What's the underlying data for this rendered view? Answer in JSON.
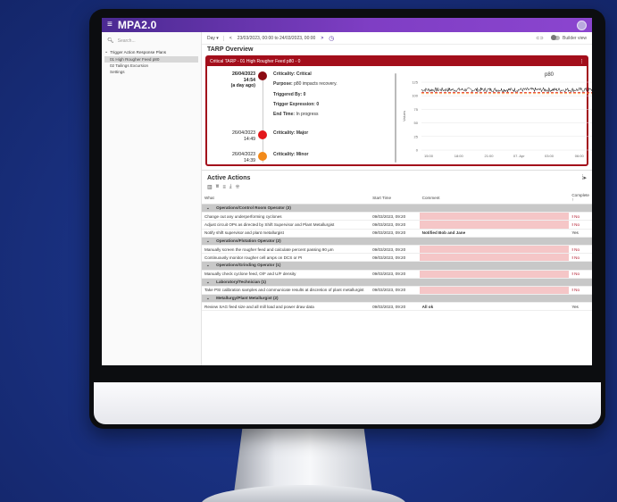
{
  "app": {
    "title": "MPA2.0",
    "menu_icon": "hamburger-icon",
    "avatar_icon": "user-avatar-icon"
  },
  "sidebar": {
    "search_placeholder": "Search...",
    "tree_root": "Trigger Action Response Plans",
    "items": [
      {
        "label": "01 High Rougher Feed p80",
        "active": true
      },
      {
        "label": "02 Tailings Excursion",
        "active": false
      },
      {
        "label": "Settings",
        "active": false
      }
    ]
  },
  "toolbar": {
    "period": "Day",
    "range": "23/03/2023, 00:00 to 24/03/2023, 00:00",
    "prev_glyph": "<",
    "next_glyph": ">",
    "link_icon": "link-icon",
    "builder_label": "Builder view"
  },
  "tarp": {
    "section_title": "TARP Overview",
    "card_title": "Critical TARP - 01 High Rougher Feed p80 - 0",
    "events": [
      {
        "date": "26/04/2023",
        "time": "14:54",
        "ago": "(a day ago)",
        "color": "#8b0a12",
        "criticality": "Criticality: Critical",
        "purpose_label": "Purpose:",
        "purpose": "p80 impacts recovery.",
        "triggered": "Triggered By: 0",
        "expression": "Trigger Expression: 0",
        "end_time_label": "End Time:",
        "end_time": "In progress"
      },
      {
        "date": "26/04/2023",
        "time": "14:49",
        "color": "#e3171b",
        "criticality": "Criticality: Major"
      },
      {
        "date": "26/04/2023",
        "time": "14:39",
        "color": "#f28a1a",
        "criticality": "Criticality: Minor"
      }
    ]
  },
  "chart_data": {
    "type": "line",
    "title": "p80",
    "ylabel": "Values",
    "ylim": [
      0,
      125
    ],
    "yticks": [
      0,
      25,
      50,
      75,
      100,
      125
    ],
    "xticks": [
      "15:00",
      "18:00",
      "21:00",
      "07. Apr",
      "03:00",
      "06:00",
      "09:00",
      "12:00",
      "15:00"
    ],
    "series": [
      {
        "style": "noisy-line",
        "color": "#111111",
        "mean": 111,
        "amplitude": 4
      }
    ],
    "threshold_lines": [
      {
        "value": 106,
        "color": "#e53935",
        "dash": true
      },
      {
        "value": 104,
        "color": "#f28a1a",
        "dash": true
      }
    ],
    "menu_icon": "chart-menu-icon"
  },
  "actions": {
    "title": "Active Actions",
    "toolbar_icons": [
      "columns-icon",
      "filter-icon",
      "density-icon",
      "export-icon",
      "group-icon"
    ],
    "columns": {
      "what": "What",
      "start": "Start Time",
      "comment": "Comment",
      "complete": "Complete"
    },
    "rows": [
      {
        "group": "Operations/Control Room Operator (3)"
      },
      {
        "what": "Change out any underperforming cyclones",
        "start": "09/03/2023, 09:20",
        "comment": "",
        "complete": "No"
      },
      {
        "what": "Adjust circuit OPs as directed by Shift Supervisor and Plant Metallurgist",
        "start": "09/03/2023, 09:20",
        "comment": "",
        "complete": "No"
      },
      {
        "what": "Notify shift supervisor and plant metallurgist",
        "start": "09/03/2023, 09:20",
        "comment": "Notified Bob and Jane",
        "complete": "Yes"
      },
      {
        "group": "Operations/Flotation Operator (2)"
      },
      {
        "what": "Manually screen the rougher feed and calculate percent passing 90 μm",
        "start": "09/03/2023, 09:20",
        "comment": "",
        "complete": "No"
      },
      {
        "what": "Continuously monitor rougher cell amps on DCS or PI",
        "start": "09/03/2023, 09:20",
        "comment": "",
        "complete": "No"
      },
      {
        "group": "Operations/Grinding Operator (1)"
      },
      {
        "what": "Manually check cyclone feed, O/F and U/F density",
        "start": "09/03/2023, 09:20",
        "comment": "",
        "complete": "No"
      },
      {
        "group": "Laboratory/Technician (1)"
      },
      {
        "what": "Take PSI calibration samples and communicate results at discretion of plant metallurgist",
        "start": "09/03/2023, 09:20",
        "comment": "",
        "complete": "No"
      },
      {
        "group": "Metallurgy/Plant Metallurgist (2)"
      },
      {
        "what": "Review SAG feed size and all mill load and power draw data",
        "start": "09/03/2023, 09:20",
        "comment": "All ok",
        "complete": "Yes"
      }
    ]
  }
}
